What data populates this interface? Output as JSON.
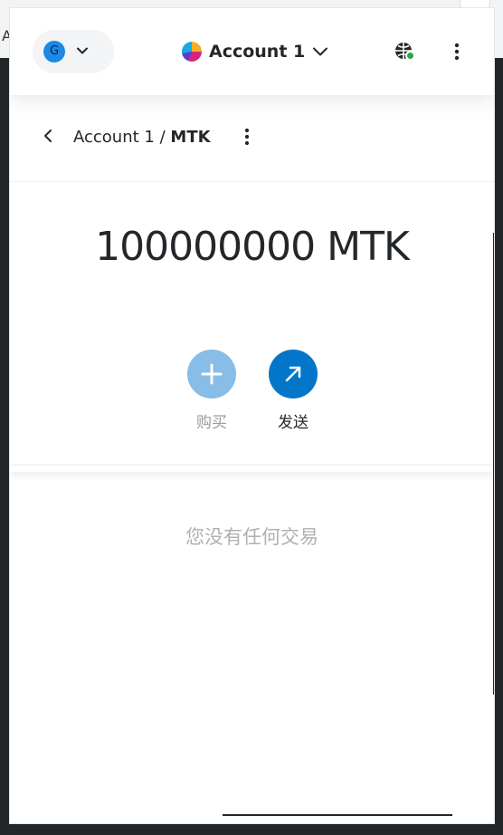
{
  "backdrop": {
    "letter": "A"
  },
  "header": {
    "network_avatar_letter": "G",
    "account_name": "Account 1"
  },
  "asset_nav": {
    "account": "Account 1",
    "separator": "/",
    "token": "MTK"
  },
  "balance": {
    "amount": "100000000",
    "symbol": "MTK"
  },
  "actions": {
    "buy_label": "购买",
    "send_label": "发送"
  },
  "transactions": {
    "empty_message": "您没有任何交易"
  },
  "colors": {
    "primary": "#0376c9",
    "primary_disabled": "#87bde6",
    "connected": "#28a745",
    "network_avatar": "#1e88e5"
  },
  "icons": [
    "chevron-down-icon",
    "globe-icon",
    "kebab-menu-icon",
    "back-chevron-icon",
    "plus-icon",
    "arrow-up-right-icon"
  ]
}
